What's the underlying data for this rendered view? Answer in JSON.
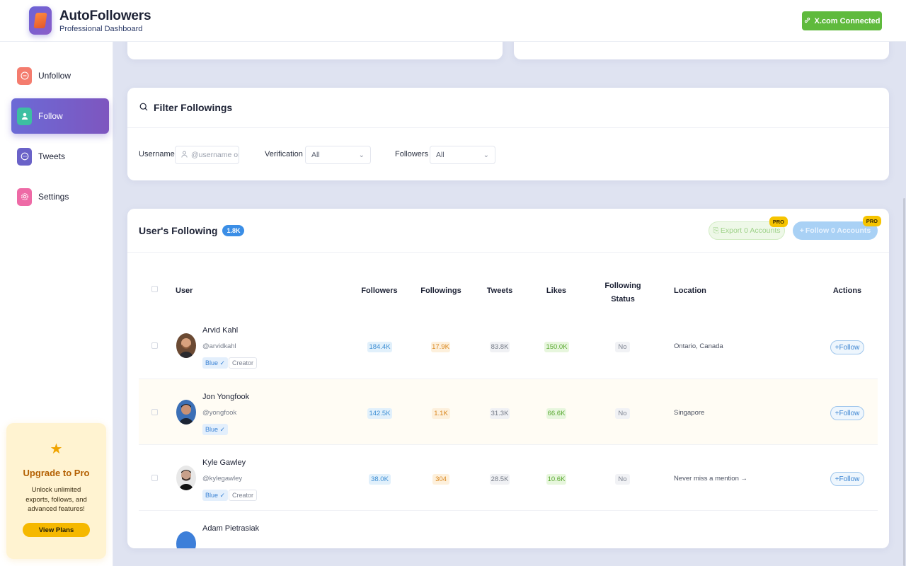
{
  "header": {
    "app_title": "AutoFollowers",
    "app_subtitle": "Professional Dashboard",
    "connected_label": "X.com Connected"
  },
  "sidebar": {
    "items": [
      {
        "label": "Unfollow",
        "icon": "minus-circle-icon"
      },
      {
        "label": "Follow",
        "icon": "user-icon",
        "active": true
      },
      {
        "label": "Tweets",
        "icon": "chat-bubble-icon"
      },
      {
        "label": "Settings",
        "icon": "gear-icon"
      }
    ],
    "upgrade": {
      "title": "Upgrade to Pro",
      "text": "Unlock unlimited exports, follows, and advanced features!",
      "button": "View Plans"
    }
  },
  "filter": {
    "title": "Filter Followings",
    "username_label": "Username",
    "username_placeholder": "@username or",
    "verification_label": "Verification",
    "verification_value": "All",
    "followers_label": "Followers",
    "followers_value": "All"
  },
  "table": {
    "title": "User's Following",
    "count": "1.8K",
    "export_label": "Export 0 Accounts",
    "follow_all_label": "Follow 0 Accounts",
    "pro_badge": "PRO",
    "columns": {
      "user": "User",
      "followers": "Followers",
      "followings": "Followings",
      "tweets": "Tweets",
      "likes": "Likes",
      "following_status_1": "Following",
      "following_status_2": "Status",
      "location": "Location",
      "actions": "Actions"
    },
    "follow_button": "Follow",
    "rows": [
      {
        "name": "Arvid Kahl",
        "handle": "@arvidkahl",
        "tags": [
          "Blue ✓",
          "Creator"
        ],
        "followers": "184.4K",
        "followings": "17.9K",
        "tweets": "83.8K",
        "likes": "150.0K",
        "status": "No",
        "location": "Ontario, Canada"
      },
      {
        "name": "Jon Yongfook",
        "handle": "@yongfook",
        "tags": [
          "Blue ✓"
        ],
        "followers": "142.5K",
        "followings": "1.1K",
        "tweets": "31.3K",
        "likes": "66.6K",
        "status": "No",
        "location": "Singapore"
      },
      {
        "name": "Kyle Gawley",
        "handle": "@kylegawley",
        "tags": [
          "Blue ✓",
          "Creator"
        ],
        "followers": "38.0K",
        "followings": "304",
        "tweets": "28.5K",
        "likes": "10.6K",
        "status": "No",
        "location": "Never miss a mention →"
      },
      {
        "name": "Adam Pietrasiak",
        "handle": "",
        "tags": [],
        "followers": "",
        "followings": "",
        "tweets": "",
        "likes": "",
        "status": "",
        "location": ""
      }
    ]
  },
  "colors": {
    "accent_purple": "#6b6ad6",
    "connected_green": "#5fba3d",
    "pro_yellow": "#f6c400"
  }
}
